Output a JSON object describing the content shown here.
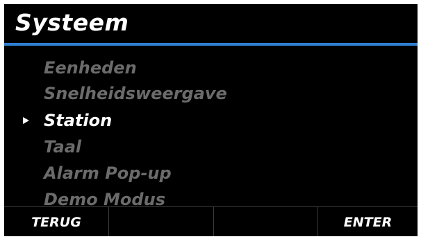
{
  "screen": {
    "title": "Systeem"
  },
  "menu": {
    "items": [
      {
        "label": "Eenheden",
        "selected": false
      },
      {
        "label": "Snelheidsweergave",
        "selected": false
      },
      {
        "label": "Station",
        "selected": true
      },
      {
        "label": "Taal",
        "selected": false
      },
      {
        "label": "Alarm Pop-up",
        "selected": false
      },
      {
        "label": "Demo Modus",
        "selected": false
      }
    ]
  },
  "softkeys": [
    "TERUG",
    "",
    "",
    "ENTER"
  ],
  "colors": {
    "background": "#000000",
    "accent_rule": "#2f7fd1",
    "selected_text": "#ffffff",
    "unselected_text": "#6b6b6b"
  }
}
